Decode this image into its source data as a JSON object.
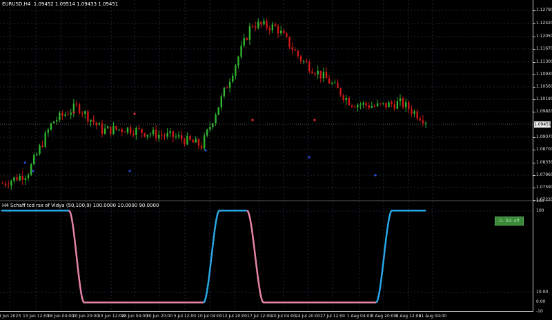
{
  "window": {
    "main_title": "EURUSD,H4  1.09452 1.09514 1.09433 1.09451",
    "indicator_title": "H4 Schaff tcd rsx of Vidya (50,100,9) 100.0000 10.0000 90.0000",
    "current_price": "1.09451",
    "trend_badge": "D. Trd: off"
  },
  "colors": {
    "bull_candle": "#2fb52f",
    "bear_candle": "#d01818",
    "grid": "#1e2a3a",
    "stc_up": "#29a8e6",
    "stc_down": "#e884a8",
    "buy_dot": "#2b4bdc",
    "sell_dot": "#e03030"
  },
  "price_axis": [
    "1.12790",
    "1.12420",
    "1.12050",
    "1.11670",
    "1.11300",
    "1.10930",
    "1.10560",
    "1.10190",
    "1.09820",
    "1.09070",
    "1.08700",
    "1.08330",
    "1.07960",
    "1.07590",
    "1.07220"
  ],
  "indicator_axis": [
    "110",
    "100",
    "10.00",
    "0.00",
    "-10"
  ],
  "time_axis": [
    "8 Jun 2023",
    "13 Jun 12:00",
    "16 Jun 04:00",
    "20 Jun 20:00",
    "23 Jun 12:00",
    "28 Jun 04:00",
    "30 Jun 20:00",
    "5 Jul 12:00",
    "10 Jul 04:00",
    "12 Jul 20:00",
    "17 Jul 12:00",
    "20 Jul 04:00",
    "24 Jul 20:00",
    "27 Jul 12:00",
    "1 Aug 04:00",
    "3 Aug 20:00",
    "8 Aug 12:00",
    "11 Aug 04:00"
  ],
  "chart_data": {
    "type": "line",
    "series": [
      {
        "x": [
          "8 Jun 2023",
          "13 Jun 12:00",
          "16 Jun 04:00",
          "20 Jun 20:00",
          "23 Jun 12:00",
          "28 Jun 04:00",
          "30 Jun 20:00",
          "5 Jul 12:00",
          "10 Jul 04:00",
          "12 Jul 20:00",
          "17 Jul 12:00",
          "20 Jul 04:00",
          "24 Jul 20:00",
          "27 Jul 12:00",
          "1 Aug 04:00",
          "3 Aug 20:00",
          "8 Aug 12:00",
          "11 Aug 04:00"
        ],
        "close": [
          1.076,
          1.079,
          1.094,
          1.0985,
          1.0915,
          1.092,
          1.0905,
          1.0895,
          1.087,
          1.1045,
          1.1225,
          1.1215,
          1.112,
          1.1065,
          1.0995,
          1.0985,
          1.0995,
          1.0945
        ]
      }
    ],
    "ylim": [
      1.0712,
      1.1295
    ],
    "indicator_ylim": [
      -10,
      110
    ]
  }
}
